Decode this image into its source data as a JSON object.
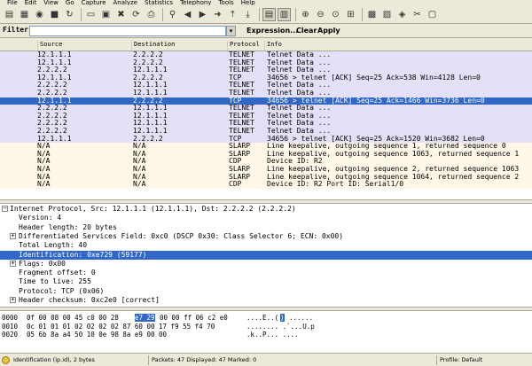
{
  "menu": [
    "File",
    "Edit",
    "View",
    "Go",
    "Capture",
    "Analyze",
    "Statistics",
    "Telephony",
    "Tools",
    "Help"
  ],
  "toolbar": {
    "icons": [
      "interface-list-icon",
      "capture-options-icon",
      "start-capture-icon",
      "stop-capture-icon",
      "restart-capture-icon",
      "open-file-icon",
      "save-file-icon",
      "close-file-icon",
      "reload-icon",
      "print-icon",
      "find-packet-icon",
      "go-back-icon",
      "go-forward-icon",
      "go-to-packet-icon",
      "go-first-icon",
      "go-last-icon",
      "colorize-icon",
      "auto-scroll-icon",
      "zoom-in-icon",
      "zoom-out-icon",
      "zoom-normal-icon",
      "resize-columns-icon",
      "capture-filters-icon",
      "display-filters-icon",
      "coloring-rules-icon",
      "preferences-icon",
      "help-icon"
    ]
  },
  "filter": {
    "label": "Filter:",
    "value": "",
    "expression_label": "Expression...",
    "clear_label": "Clear",
    "apply_label": "Apply"
  },
  "packet_list": {
    "columns": [
      "Source",
      "Destination",
      "Protocol",
      "Info"
    ],
    "rows": [
      {
        "src": "12.1.1.1",
        "dst": "2.2.2.2",
        "proto": "TELNET",
        "info": "Telnet Data ...",
        "bg": "#e4e0f7",
        "selected": false
      },
      {
        "src": "12.1.1.1",
        "dst": "2.2.2.2",
        "proto": "TELNET",
        "info": "Telnet Data ...",
        "bg": "#e4e0f7",
        "selected": false
      },
      {
        "src": "2.2.2.2",
        "dst": "12.1.1.1",
        "proto": "TELNET",
        "info": "Telnet Data ...",
        "bg": "#e4e0f7",
        "selected": false
      },
      {
        "src": "12.1.1.1",
        "dst": "2.2.2.2",
        "proto": "TCP",
        "info": "34656 > telnet [ACK] Seq=25 Ack=538 Win=4128 Len=0",
        "bg": "#e4e0f7",
        "selected": false
      },
      {
        "src": "2.2.2.2",
        "dst": "12.1.1.1",
        "proto": "TELNET",
        "info": "Telnet Data ...",
        "bg": "#e4e0f7",
        "selected": false
      },
      {
        "src": "2.2.2.2",
        "dst": "12.1.1.1",
        "proto": "TELNET",
        "info": "Telnet Data ...",
        "bg": "#e4e0f7",
        "selected": false
      },
      {
        "src": "12.1.1.1",
        "dst": "2.2.2.2",
        "proto": "TCP",
        "info": "34656 > telnet [ACK] Seq=25 Ack=1466 Win=3736 Len=0",
        "bg": "#3167c6",
        "selected": true
      },
      {
        "src": "2.2.2.2",
        "dst": "12.1.1.1",
        "proto": "TELNET",
        "info": "Telnet Data ...",
        "bg": "#e4e0f7",
        "selected": false
      },
      {
        "src": "2.2.2.2",
        "dst": "12.1.1.1",
        "proto": "TELNET",
        "info": "Telnet Data ...",
        "bg": "#e4e0f7",
        "selected": false
      },
      {
        "src": "2.2.2.2",
        "dst": "12.1.1.1",
        "proto": "TELNET",
        "info": "Telnet Data ...",
        "bg": "#e4e0f7",
        "selected": false
      },
      {
        "src": "2.2.2.2",
        "dst": "12.1.1.1",
        "proto": "TELNET",
        "info": "Telnet Data ...",
        "bg": "#e4e0f7",
        "selected": false
      },
      {
        "src": "12.1.1.1",
        "dst": "2.2.2.2",
        "proto": "TCP",
        "info": "34656 > telnet [ACK] Seq=25 Ack=1520 Win=3682 Len=0",
        "bg": "#e4e0f7",
        "selected": false
      },
      {
        "src": "N/A",
        "dst": "N/A",
        "proto": "SLARP",
        "info": "Line keepalive, outgoing sequence 1, returned sequence 0",
        "bg": "#fff8e8",
        "selected": false
      },
      {
        "src": "N/A",
        "dst": "N/A",
        "proto": "SLARP",
        "info": "Line keepalive, outgoing sequence 1063, returned sequence 1",
        "bg": "#fff8e8",
        "selected": false
      },
      {
        "src": "N/A",
        "dst": "N/A",
        "proto": "CDP",
        "info": "Device ID: R2",
        "bg": "#fff8e8",
        "selected": false
      },
      {
        "src": "N/A",
        "dst": "N/A",
        "proto": "SLARP",
        "info": "Line keepalive, outgoing sequence 2, returned sequence 1063",
        "bg": "#fff8e8",
        "selected": false
      },
      {
        "src": "N/A",
        "dst": "N/A",
        "proto": "SLARP",
        "info": "Line keepalive, outgoing sequence 1064, returned sequence 2",
        "bg": "#fff8e8",
        "selected": false
      },
      {
        "src": "N/A",
        "dst": "N/A",
        "proto": "CDP",
        "info": "Device ID: R2  Port ID: Serial1/0",
        "bg": "#fff8e8",
        "selected": false
      }
    ]
  },
  "details": [
    {
      "text": "Internet Protocol, Src: 12.1.1.1 (12.1.1.1), Dst: 2.2.2.2 (2.2.2.2)",
      "indent": 0,
      "toggle": "minus",
      "selected": false
    },
    {
      "text": "Version: 4",
      "indent": 1,
      "toggle": "",
      "selected": false
    },
    {
      "text": "Header length: 20 bytes",
      "indent": 1,
      "toggle": "",
      "selected": false
    },
    {
      "text": "Differentiated Services Field: 0xc0 (DSCP 0x30: Class Selector 6; ECN: 0x00)",
      "indent": 1,
      "toggle": "plus",
      "selected": false
    },
    {
      "text": "Total Length: 40",
      "indent": 1,
      "toggle": "",
      "selected": false
    },
    {
      "text": "Identification: 0xe729 (59177)",
      "indent": 1,
      "toggle": "",
      "selected": true
    },
    {
      "text": "Flags: 0x00",
      "indent": 1,
      "toggle": "plus",
      "selected": false
    },
    {
      "text": "Fragment offset: 0",
      "indent": 1,
      "toggle": "",
      "selected": false
    },
    {
      "text": "Time to live: 255",
      "indent": 1,
      "toggle": "",
      "selected": false
    },
    {
      "text": "Protocol: TCP (0x06)",
      "indent": 1,
      "toggle": "",
      "selected": false
    },
    {
      "text": "Header checksum: 0xc2e0 [correct]",
      "indent": 1,
      "toggle": "plus",
      "selected": false
    }
  ],
  "hex": [
    {
      "offset": "0000",
      "pre": "0f 00 08 00 45 c0 00 28",
      "hl": "e7 29",
      "post": "00 00 ff 06 c2 e0",
      "ascii_pre": "....E..(",
      "ascii_hl": " )",
      "ascii_post": "......"
    },
    {
      "offset": "0010",
      "pre": "0c 01 01 01 02 02 02 02  87 60 00 17 f9 55 f4 70",
      "hl": "",
      "post": "",
      "ascii_pre": "........ .`...U.p",
      "ascii_hl": "",
      "ascii_post": ""
    },
    {
      "offset": "0020",
      "pre": "05 6b 8a a4 50 10 0e 98  8a e9 00 00",
      "hl": "",
      "post": "",
      "ascii_pre": ".k..P... ....",
      "ascii_hl": "",
      "ascii_post": ""
    }
  ],
  "status": {
    "field": "Identification (ip.id), 2 bytes",
    "counts": "Packets: 47 Displayed: 47 Marked: 0",
    "profile": "Profile: Default"
  },
  "colors": {
    "selection": "#3167c6",
    "tcp_row": "#e4e0f7",
    "misc_row": "#fff8e8"
  }
}
